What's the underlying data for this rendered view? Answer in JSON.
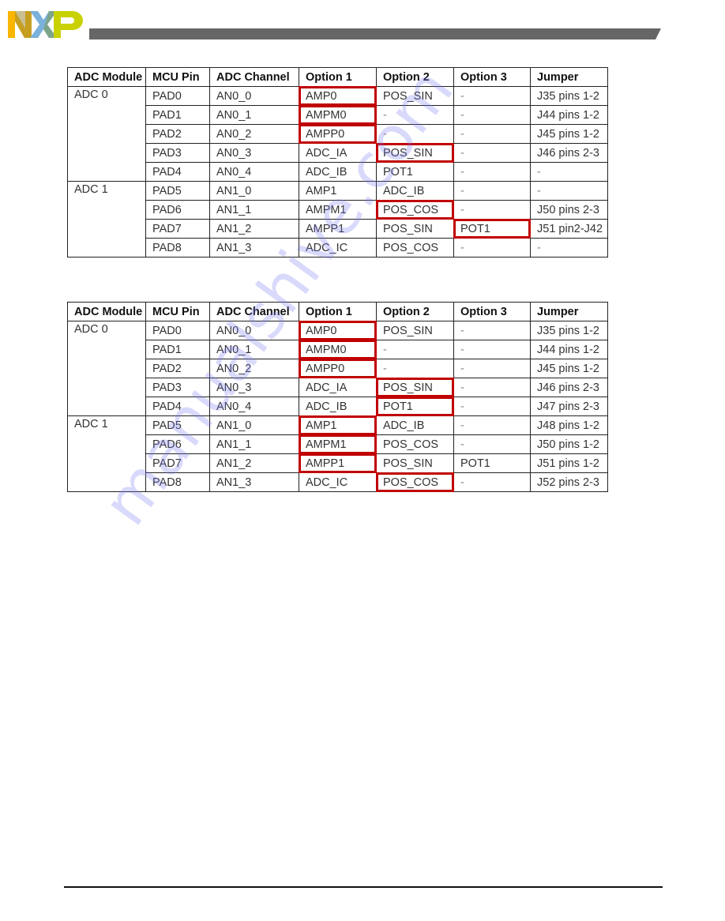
{
  "header": {
    "logo": "NXP",
    "logo_colors": {
      "N": "#f9b500",
      "X": "#7bb1db",
      "P": "#c9d200"
    },
    "bar_color": "#666666"
  },
  "highlight_color": "#c00000",
  "tables": [
    {
      "columns": [
        "ADC Module",
        "MCU Pin",
        "ADC Channel",
        "Option 1",
        "Option 2",
        "Option 3",
        "Jumper"
      ],
      "groups": [
        {
          "module": "ADC 0",
          "rows": [
            {
              "pin": "PAD0",
              "channel": "AN0_0",
              "opt1": "AMP0",
              "opt2": "POS_SIN",
              "opt3": "-",
              "jumper": "J35 pins 1-2",
              "highlight": "opt1"
            },
            {
              "pin": "PAD1",
              "channel": "AN0_1",
              "opt1": "AMPM0",
              "opt2": "-",
              "opt3": "-",
              "jumper": "J44 pins 1-2",
              "highlight": "opt1"
            },
            {
              "pin": "PAD2",
              "channel": "AN0_2",
              "opt1": "AMPP0",
              "opt2": "-",
              "opt3": "-",
              "jumper": "J45 pins 1-2",
              "highlight": "opt1"
            },
            {
              "pin": "PAD3",
              "channel": "AN0_3",
              "opt1": "ADC_IA",
              "opt2": "POS_SIN",
              "opt3": "-",
              "jumper": "J46 pins 2-3",
              "highlight": "opt2"
            },
            {
              "pin": "PAD4",
              "channel": "AN0_4",
              "opt1": "ADC_IB",
              "opt2": "POT1",
              "opt3": "-",
              "jumper": "-",
              "highlight": ""
            }
          ]
        },
        {
          "module": "ADC 1",
          "rows": [
            {
              "pin": "PAD5",
              "channel": "AN1_0",
              "opt1": "AMP1",
              "opt2": "ADC_IB",
              "opt3": "-",
              "jumper": "-",
              "highlight": ""
            },
            {
              "pin": "PAD6",
              "channel": "AN1_1",
              "opt1": "AMPM1",
              "opt2": "POS_COS",
              "opt3": "-",
              "jumper": "J50 pins 2-3",
              "highlight": "opt2"
            },
            {
              "pin": "PAD7",
              "channel": "AN1_2",
              "opt1": "AMPP1",
              "opt2": "POS_SIN",
              "opt3": "POT1",
              "jumper": "J51 pin2-J42",
              "highlight": "opt3"
            },
            {
              "pin": "PAD8",
              "channel": "AN1_3",
              "opt1": "ADC_IC",
              "opt2": "POS_COS",
              "opt3": "-",
              "jumper": "-",
              "highlight": ""
            }
          ]
        }
      ]
    },
    {
      "columns": [
        "ADC Module",
        "MCU Pin",
        "ADC Channel",
        "Option 1",
        "Option 2",
        "Option 3",
        "Jumper"
      ],
      "groups": [
        {
          "module": "ADC 0",
          "rows": [
            {
              "pin": "PAD0",
              "channel": "AN0_0",
              "opt1": "AMP0",
              "opt2": "POS_SIN",
              "opt3": "-",
              "jumper": "J35 pins 1-2",
              "highlight": "opt1"
            },
            {
              "pin": "PAD1",
              "channel": "AN0_1",
              "opt1": "AMPM0",
              "opt2": "-",
              "opt3": "-",
              "jumper": "J44 pins 1-2",
              "highlight": "opt1"
            },
            {
              "pin": "PAD2",
              "channel": "AN0_2",
              "opt1": "AMPP0",
              "opt2": "-",
              "opt3": "-",
              "jumper": "J45 pins 1-2",
              "highlight": "opt1"
            },
            {
              "pin": "PAD3",
              "channel": "AN0_3",
              "opt1": "ADC_IA",
              "opt2": "POS_SIN",
              "opt3": "-",
              "jumper": "J46 pins 2-3",
              "highlight": "opt2"
            },
            {
              "pin": "PAD4",
              "channel": "AN0_4",
              "opt1": "ADC_IB",
              "opt2": "POT1",
              "opt3": "-",
              "jumper": "J47 pins 2-3",
              "highlight": "opt2"
            }
          ]
        },
        {
          "module": "ADC 1",
          "rows": [
            {
              "pin": "PAD5",
              "channel": "AN1_0",
              "opt1": "AMP1",
              "opt2": "ADC_IB",
              "opt3": "-",
              "jumper": "J48 pins 1-2",
              "highlight": "opt1"
            },
            {
              "pin": "PAD6",
              "channel": "AN1_1",
              "opt1": "AMPM1",
              "opt2": "POS_COS",
              "opt3": "-",
              "jumper": "J50 pins 1-2",
              "highlight": "opt1"
            },
            {
              "pin": "PAD7",
              "channel": "AN1_2",
              "opt1": "AMPP1",
              "opt2": "POS_SIN",
              "opt3": "POT1",
              "jumper": "J51 pins 1-2",
              "highlight": "opt1"
            },
            {
              "pin": "PAD8",
              "channel": "AN1_3",
              "opt1": "ADC_IC",
              "opt2": "POS_COS",
              "opt3": "-",
              "jumper": "J52 pins 2-3",
              "highlight": "opt2"
            }
          ]
        }
      ]
    }
  ],
  "watermark": "manualshive.com"
}
